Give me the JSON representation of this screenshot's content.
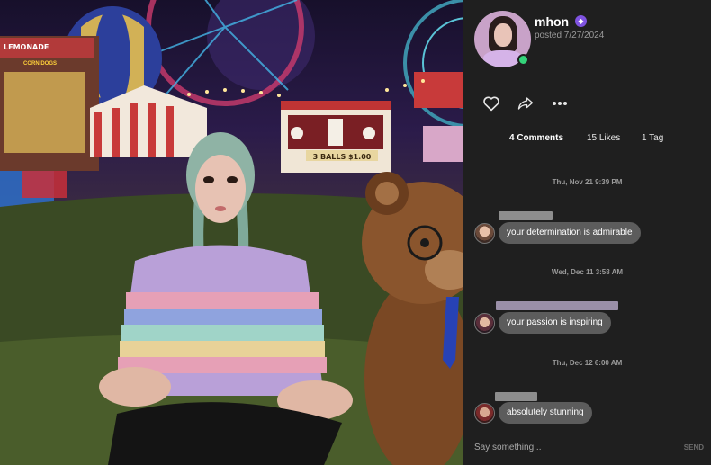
{
  "photo": {
    "booth_sign": "3 BALLS $1.00",
    "stand_sign": "LEMONADE",
    "stand_sign_2": "CORN DOGS"
  },
  "post": {
    "username": "mhon",
    "posted": "posted 7/27/2024"
  },
  "actions": {
    "like_icon": "heart-icon",
    "share_icon": "share-icon",
    "more_icon": "more-icon"
  },
  "tabs": [
    {
      "label": "4 Comments"
    },
    {
      "label": "15 Likes"
    },
    {
      "label": "1 Tag"
    }
  ],
  "comments": [
    {
      "timestamp": "Thu, Nov 21 9:39 PM",
      "text": "your determination is admirable"
    },
    {
      "timestamp": "Wed, Dec 11 3:58 AM",
      "text": "your passion is inspiring"
    },
    {
      "timestamp": "Thu, Dec 12 6:00 AM",
      "text": "absolutely stunning"
    }
  ],
  "composer": {
    "placeholder": "Say something...",
    "send_label": "SEND"
  },
  "colors": {
    "panel_bg": "#1f1f1f",
    "bubble_bg": "#5c5c5c",
    "online": "#34d47a",
    "vip": "#7f53e0"
  }
}
